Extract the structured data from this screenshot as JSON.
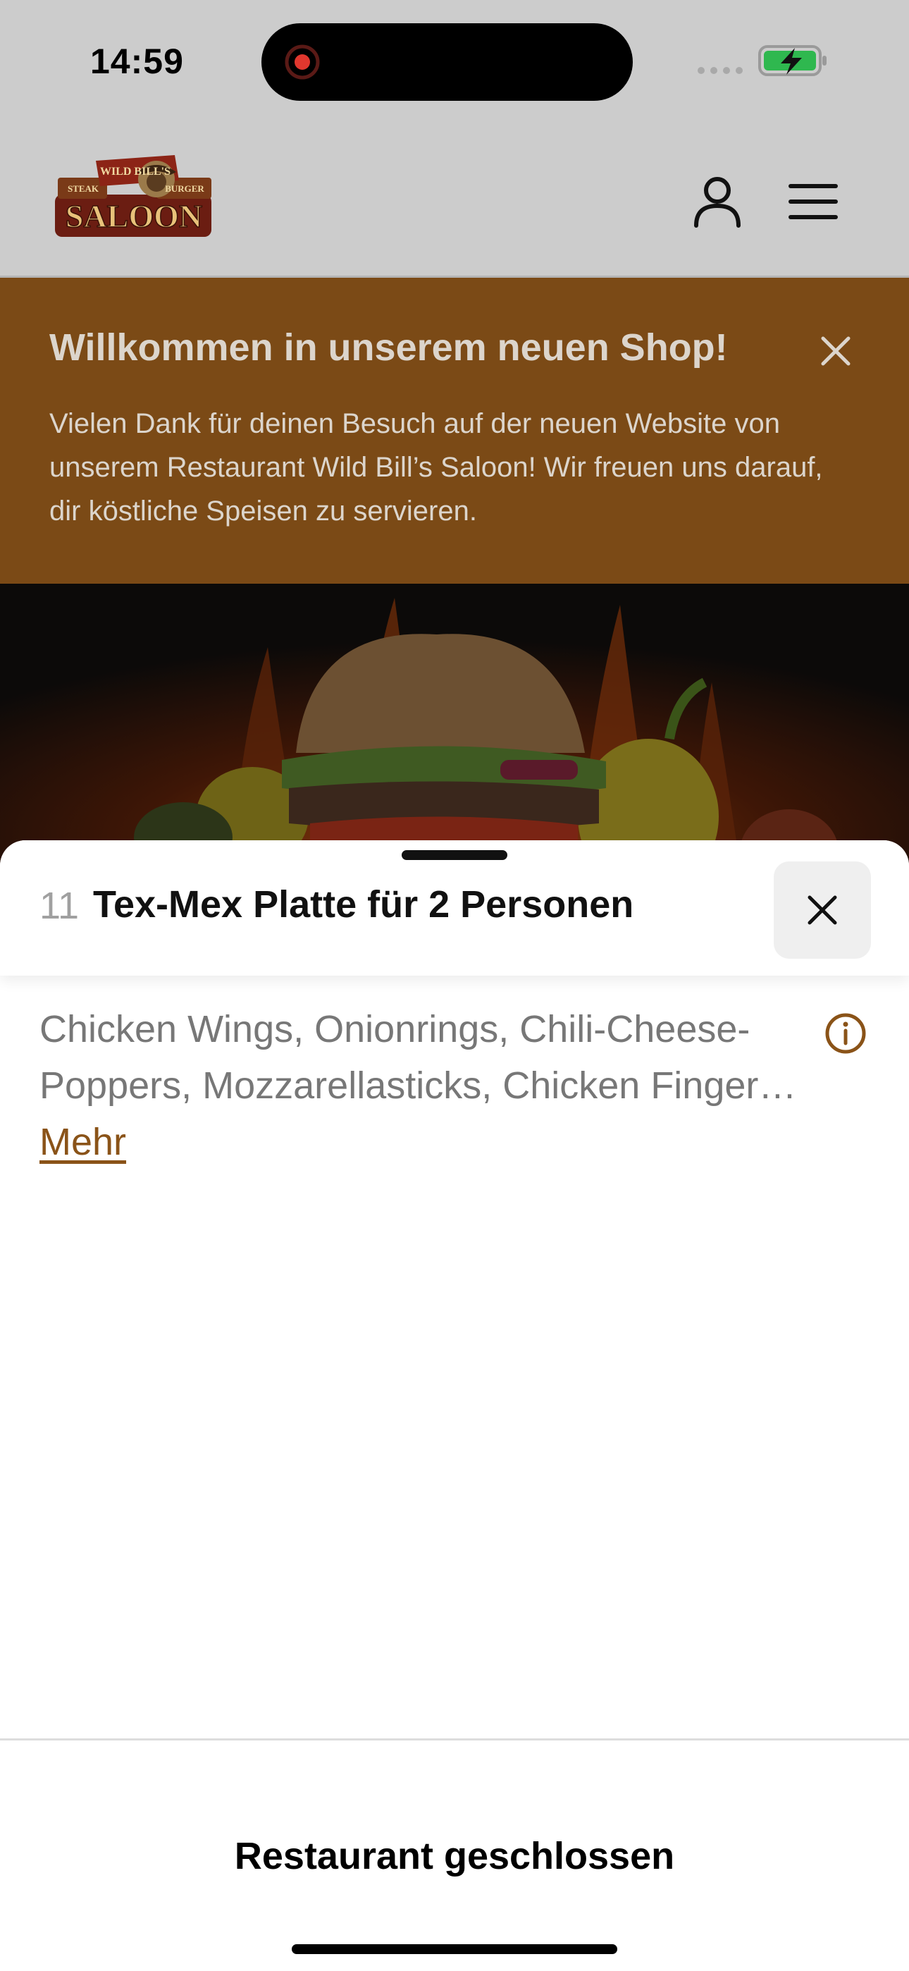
{
  "status_bar": {
    "time": "14:59"
  },
  "header": {
    "logo_text": "WILD BILL'S STEAK BURGER SALOON",
    "user_icon": "user-icon",
    "menu_icon": "hamburger-menu-icon"
  },
  "banner": {
    "title": "Willkommen in unserem neuen Shop!",
    "text": "Vielen Dank für deinen Besuch auf der neuen Website von unserem Restaurant Wild Bill’s Saloon! Wir freuen uns darauf, dir köstliche Speisen zu servieren.",
    "close_icon": "close-icon"
  },
  "sheet": {
    "item_number": "11",
    "item_title": "Tex-Mex Platte für 2 Personen",
    "description": "Chicken Wings, Onionrings, Chili-Cheese-Poppers, Mozzarellasticks, Chicken Fingers, Jalapeños und Dips",
    "more_label": "Mehr",
    "info_icon": "info-icon",
    "close_icon": "close-icon"
  },
  "footer": {
    "status": "Restaurant geschlossen"
  },
  "colors": {
    "brand_brown": "#7b4a16",
    "link_brown": "#8a5318",
    "overlay_gray": "#cccccc"
  }
}
